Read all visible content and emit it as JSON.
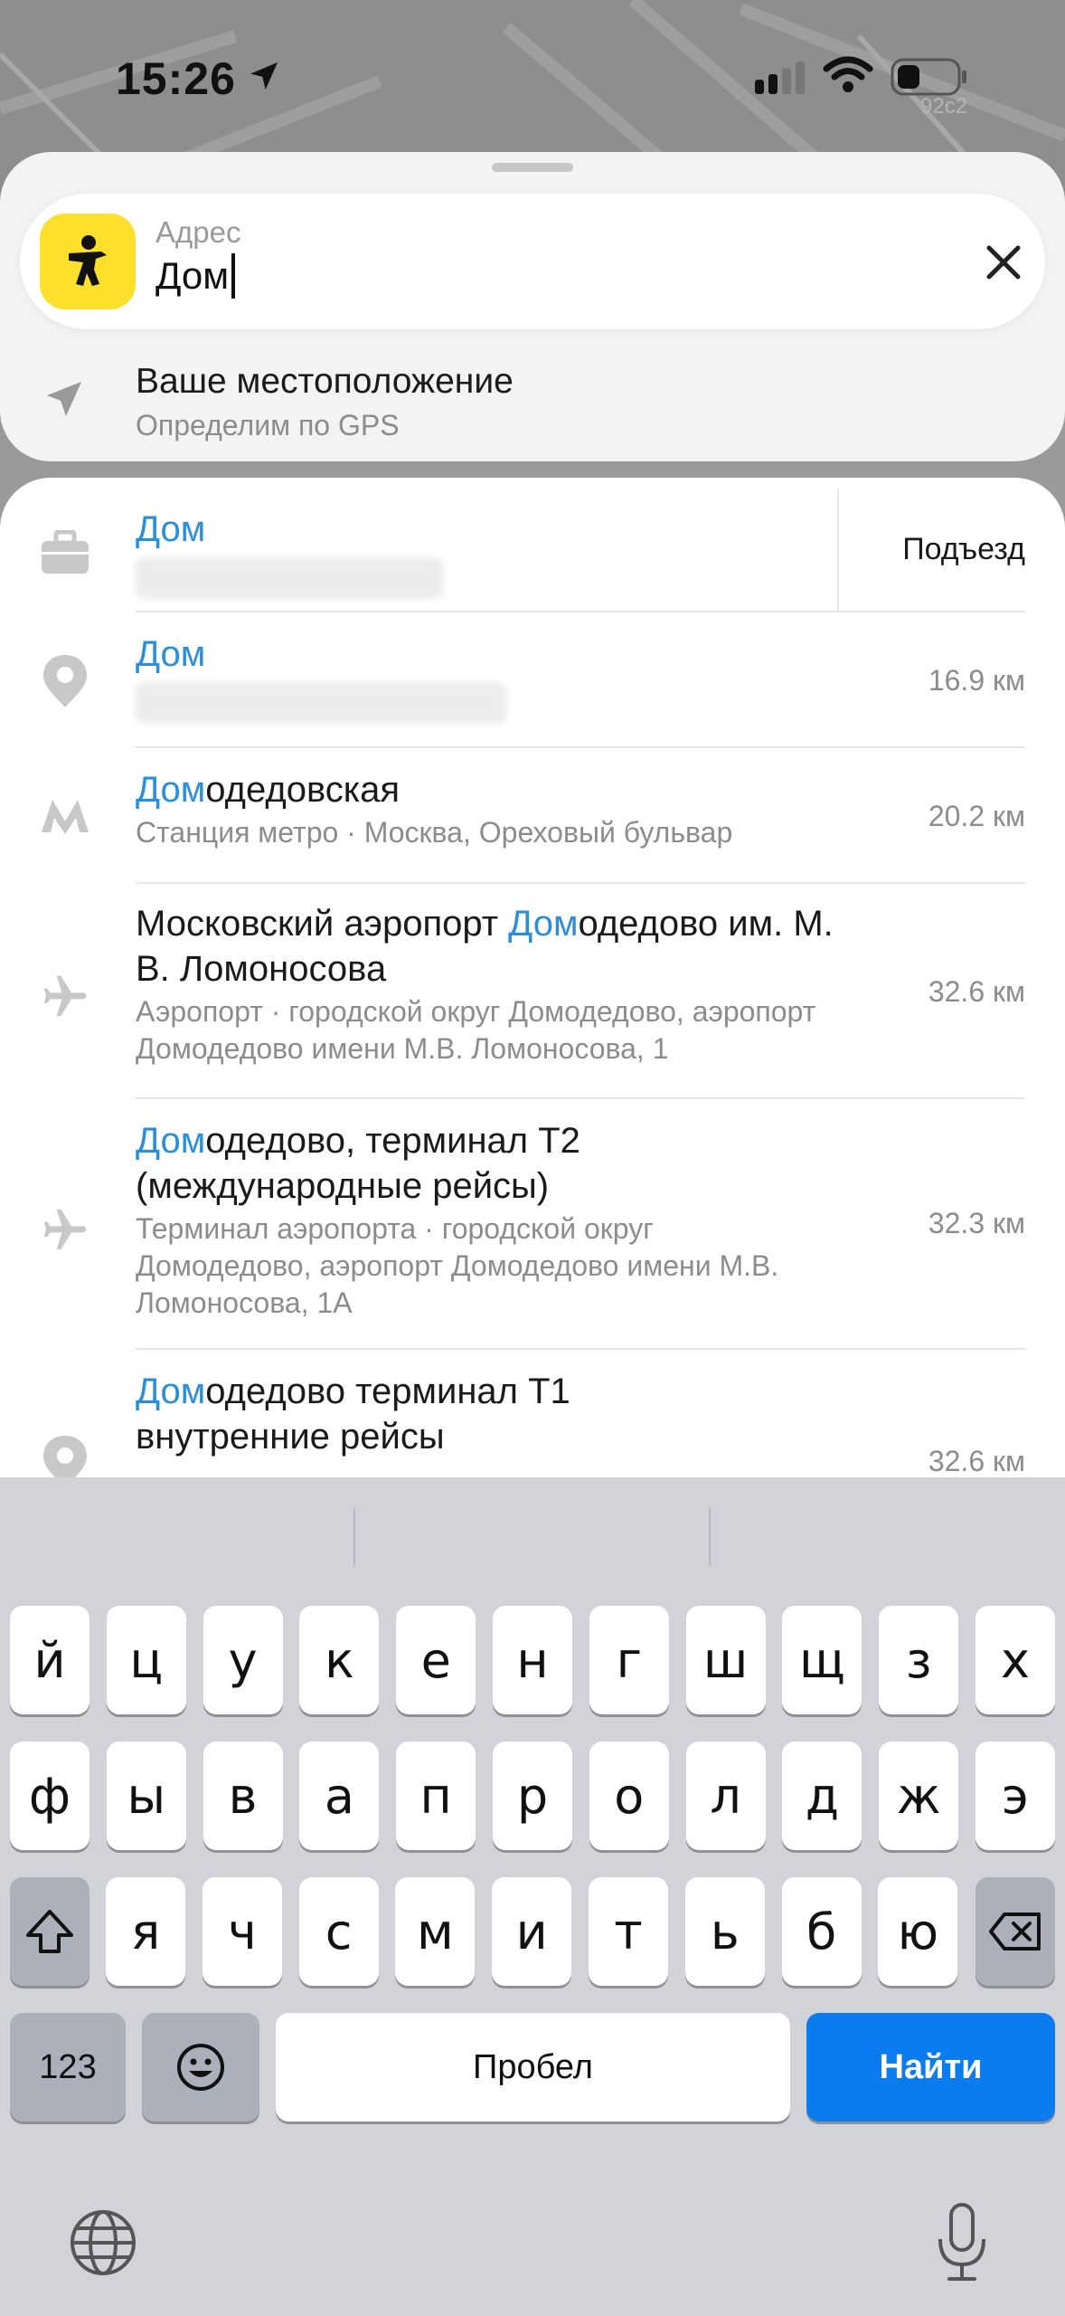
{
  "status": {
    "time": "15:26",
    "map_label": "92с2"
  },
  "search": {
    "label": "Адрес",
    "value": "Дом",
    "clear_icon": "close-icon",
    "app_icon": "person-pointing-icon"
  },
  "current_location": {
    "title": "Ваше местоположение",
    "subtitle": "Определим по GPS",
    "icon": "navigation-arrow-icon"
  },
  "results": [
    {
      "icon": "briefcase-icon",
      "title_hl": "Дом",
      "title_rest": "",
      "subtitle": "",
      "subtitle_blurred": true,
      "action": "Подъезд"
    },
    {
      "icon": "pin-icon",
      "title_hl": "Дом",
      "title_rest": "",
      "subtitle": "",
      "subtitle_blurred": true,
      "distance": "16.9 км"
    },
    {
      "icon": "metro-icon",
      "title_hl": "Дом",
      "title_rest": "одедовская",
      "subtitle": "Станция метро · Москва, Ореховый бульвар",
      "distance": "20.2 км"
    },
    {
      "icon": "airplane-icon",
      "title_pre": "Московский аэропорт ",
      "title_hl": "Дом",
      "title_rest": "одедово им. М.",
      "title_line2": "В. Ломоносова",
      "subtitle": "Аэропорт · городской округ Домодедово, аэропорт",
      "subtitle_line2": "Домодедово имени М.В. Ломоносова, 1",
      "distance": "32.6 км"
    },
    {
      "icon": "airplane-icon",
      "title_hl": "Дом",
      "title_rest": "одедово, терминал Т2",
      "title_line2": "(международные рейсы)",
      "subtitle": "Терминал аэропорта · городской округ",
      "subtitle_line2": "Домодедово, аэропорт Домодедово имени М.В.",
      "subtitle_line3": "Ломоносова, 1А",
      "distance": "32.3 км"
    },
    {
      "icon": "pin-icon",
      "title_hl": "Дом",
      "title_rest": "одедово терминал Т1",
      "title_line2": "внутренние рейсы",
      "distance": "32.6 км"
    }
  ],
  "keyboard": {
    "row1": [
      "й",
      "ц",
      "у",
      "к",
      "е",
      "н",
      "г",
      "ш",
      "щ",
      "з",
      "х"
    ],
    "row2": [
      "ф",
      "ы",
      "в",
      "а",
      "п",
      "р",
      "о",
      "л",
      "д",
      "ж",
      "э"
    ],
    "row3": [
      "я",
      "ч",
      "с",
      "м",
      "и",
      "т",
      "ь",
      "б",
      "ю"
    ],
    "numbers_key": "123",
    "space_key": "Пробел",
    "action_key": "Найти",
    "accent": "#0a7cf0"
  }
}
